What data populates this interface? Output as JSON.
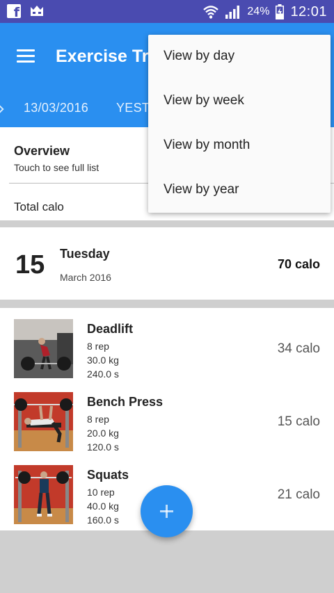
{
  "status_bar": {
    "battery_percent": "24%",
    "time": "12:01",
    "icons": [
      "facebook-icon",
      "crown-icon",
      "wifi-icon",
      "signal-icon",
      "battery-charging-icon"
    ]
  },
  "app_bar": {
    "title": "Exercise Tr",
    "tabs": [
      {
        "label": "13/03/2016"
      },
      {
        "label": "YEST"
      }
    ],
    "bg_color": "#2a8ff0"
  },
  "overview": {
    "title": "Overview",
    "subtitle": "Touch to see full list",
    "total_label": "Total calo"
  },
  "day_summary": {
    "day_number": "15",
    "weekday": "Tuesday",
    "month_year": "March 2016",
    "total": "70 calo"
  },
  "exercises": [
    {
      "name": "Deadlift",
      "reps": "8 rep",
      "weight": "30.0 kg",
      "duration": "240.0 s",
      "calories": "34 calo"
    },
    {
      "name": "Bench Press",
      "reps": "8 rep",
      "weight": "20.0 kg",
      "duration": "120.0 s",
      "calories": "15 calo"
    },
    {
      "name": "Squats",
      "reps": "10 rep",
      "weight": "40.0 kg",
      "duration": "160.0 s",
      "calories": "21 calo"
    }
  ],
  "fab": {
    "icon": "plus-icon"
  },
  "view_menu": {
    "items": [
      {
        "label": "View by day"
      },
      {
        "label": "View by week"
      },
      {
        "label": "View by month"
      },
      {
        "label": "View by year"
      }
    ]
  }
}
